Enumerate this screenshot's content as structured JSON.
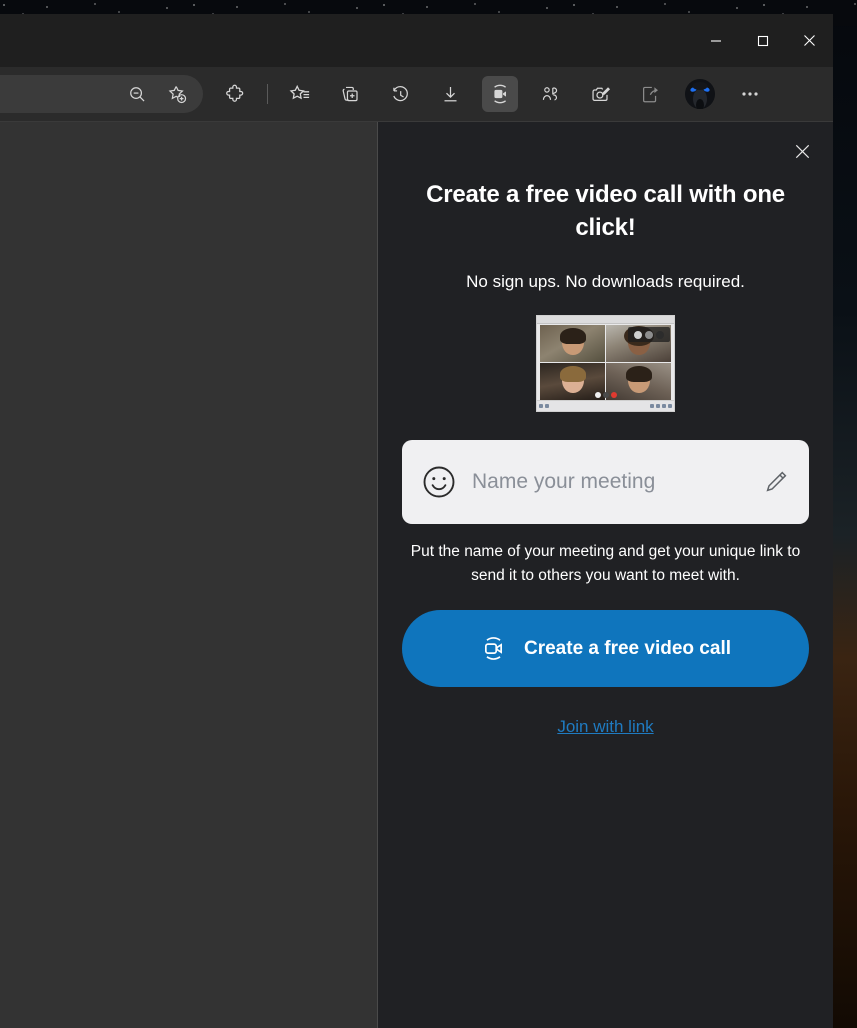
{
  "window": {
    "controls": {
      "minimize_label": "Minimize",
      "maximize_label": "Maximize",
      "close_label": "Close"
    }
  },
  "toolbar": {
    "address_actions": [
      {
        "name": "zoom-out-icon",
        "label": "Zoom out"
      },
      {
        "name": "add-favorite-icon",
        "label": "Add this page to favorites"
      }
    ],
    "buttons": [
      {
        "name": "extensions-icon",
        "label": "Extensions"
      },
      {
        "name": "favorites-icon",
        "label": "Favorites"
      },
      {
        "name": "collections-icon",
        "label": "Collections"
      },
      {
        "name": "history-icon",
        "label": "Browser essentials"
      },
      {
        "name": "downloads-icon",
        "label": "Downloads"
      },
      {
        "name": "video-call-icon",
        "label": "Create a free video call"
      },
      {
        "name": "split-screen-icon",
        "label": "Split screen"
      },
      {
        "name": "screenshot-icon",
        "label": "Screenshot"
      },
      {
        "name": "share-icon",
        "label": "Share"
      }
    ],
    "avatar_label": "Profile",
    "more_label": "Settings and more"
  },
  "panel": {
    "close_label": "Close",
    "title": "Create a free video call with one click!",
    "subtitle": "No sign ups. No downloads required.",
    "thumbnail_label": "Video call preview with four participants",
    "meeting_name": {
      "placeholder": "Name your meeting",
      "value": "",
      "emoji_icon_label": "Add emoji",
      "edit_icon_label": "Edit meeting name"
    },
    "help_text": "Put the name of your meeting and get your unique link to send it to others you want to meet with.",
    "cta_label": "Create a free video call",
    "join_link_label": "Join with link"
  },
  "colors": {
    "accent_blue": "#0f75bd",
    "link_blue": "#1f7bc1",
    "panel_bg": "#202124",
    "window_bg": "#2b2b2b",
    "page_bg": "#333333",
    "field_bg": "#f0f0f2"
  }
}
